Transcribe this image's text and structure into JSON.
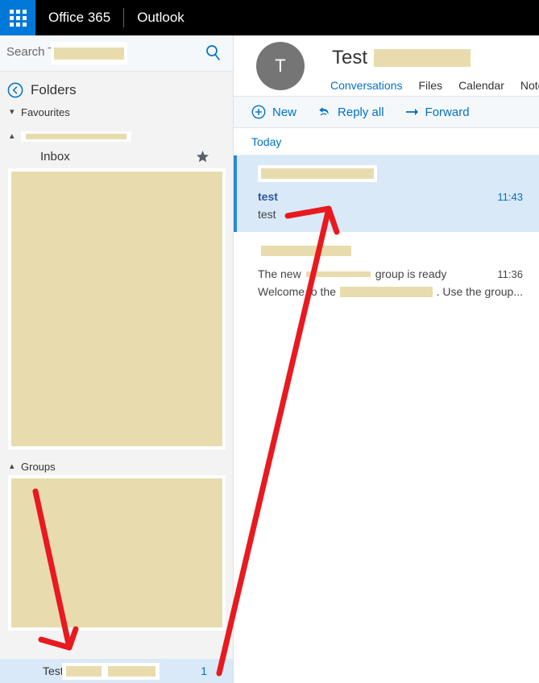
{
  "suite_bar": {
    "waffle_icon": "app-launcher-waffle-icon",
    "brand": "Office 365",
    "app": "Outlook"
  },
  "search": {
    "placeholder": "Search Test",
    "icon": "search-icon",
    "redacted": true
  },
  "sidebar": {
    "back_icon": "back-arrow-circle-icon",
    "title": "Folders",
    "favourites": {
      "label": "Favourites",
      "chevron": "chevron-down-icon"
    },
    "account": {
      "label": "",
      "chevron": "chevron-up-icon",
      "redacted": true
    },
    "inbox": {
      "label": "Inbox",
      "star_icon": "star-icon"
    },
    "folder_list_redacted": true,
    "groups": {
      "label": "Groups",
      "chevron": "chevron-up-icon",
      "list_redacted": true
    },
    "selected_group": {
      "label": "Test",
      "count": "1",
      "redacted": true
    }
  },
  "group_header": {
    "avatar_initial": "T",
    "title": "Test",
    "title_redacted": true,
    "tabs": [
      {
        "label": "Conversations",
        "active": true
      },
      {
        "label": "Files",
        "active": false
      },
      {
        "label": "Calendar",
        "active": false
      },
      {
        "label": "Note",
        "active": false
      }
    ]
  },
  "toolbar": {
    "new_label": "New",
    "new_icon": "plus-circle-icon",
    "reply_all_label": "Reply all",
    "reply_all_icon": "reply-all-icon",
    "forward_label": "Forward",
    "forward_icon": "forward-arrow-icon"
  },
  "messages": {
    "day_group": "Today",
    "items": [
      {
        "sender_redacted": true,
        "subject": "test",
        "time": "11:43",
        "preview": "test",
        "selected": true
      },
      {
        "sender_redacted": true,
        "subject_prefix": "The new",
        "subject_suffix": "group is ready",
        "time": "11:36",
        "preview_prefix": "Welcome to the",
        "preview_suffix": ". Use the group...",
        "selected": false
      }
    ]
  },
  "annotations": {
    "color": "#e8191f",
    "arrow_long_name": "red-arrow-pointing-to-message-list",
    "arrow_short_name": "red-arrow-pointing-to-groups-list"
  }
}
